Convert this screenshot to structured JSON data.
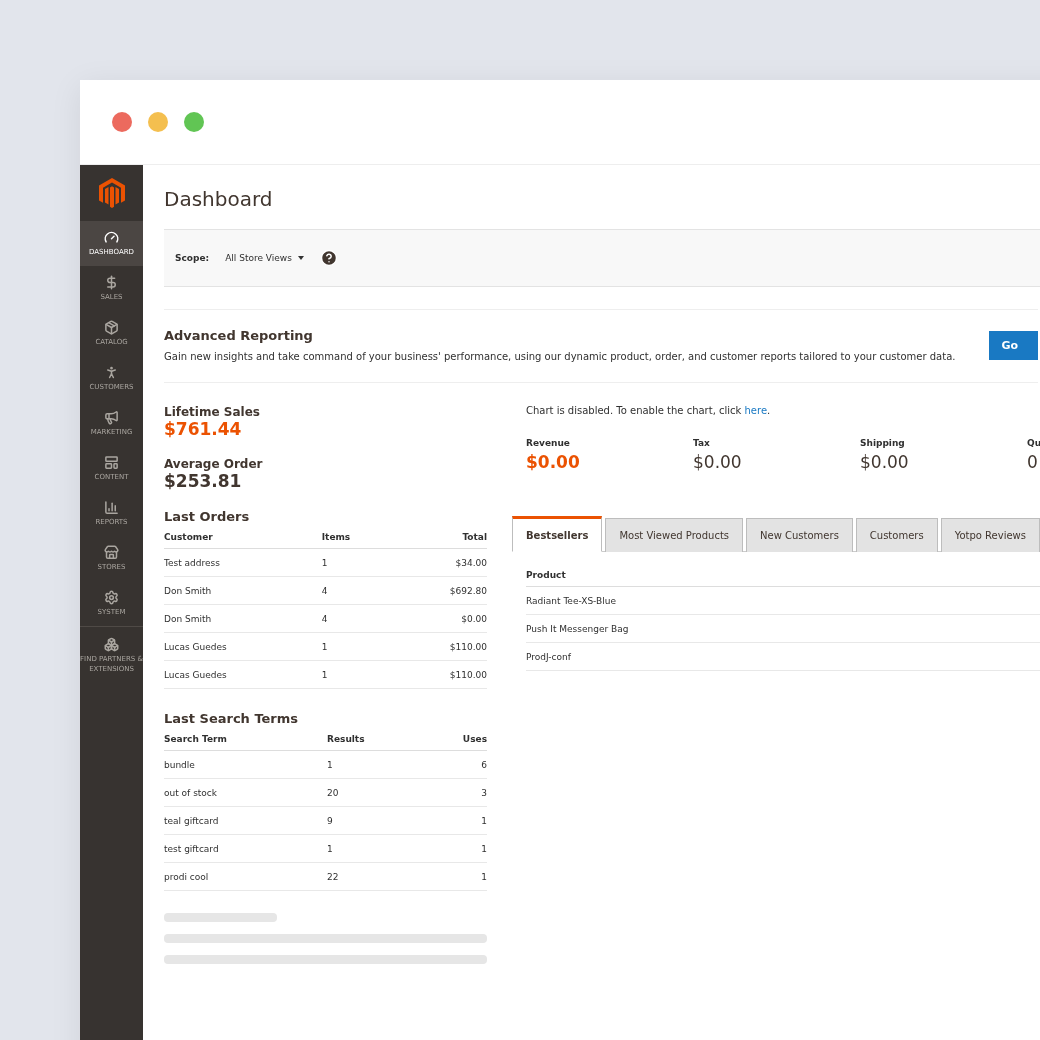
{
  "sidebar": {
    "items": [
      {
        "label": "DASHBOARD",
        "selected": true
      },
      {
        "label": "SALES",
        "selected": false
      },
      {
        "label": "CATALOG",
        "selected": false
      },
      {
        "label": "CUSTOMERS",
        "selected": false
      },
      {
        "label": "MARKETING",
        "selected": false
      },
      {
        "label": "CONTENT",
        "selected": false
      },
      {
        "label": "REPORTS",
        "selected": false
      },
      {
        "label": "STORES",
        "selected": false
      },
      {
        "label": "SYSTEM",
        "selected": false
      },
      {
        "label": "FIND PARTNERS & EXTENSIONS",
        "selected": false
      }
    ]
  },
  "page_title": "Dashboard",
  "scope": {
    "label": "Scope:",
    "value": "All Store Views"
  },
  "advanced_reporting": {
    "title": "Advanced Reporting",
    "text": "Gain new insights and take command of your business' performance, using our dynamic product, order, and customer reports tailored to your customer data.",
    "button": "Go"
  },
  "lifetime_sales": {
    "label": "Lifetime Sales",
    "value": "$761.44"
  },
  "average_order": {
    "label": "Average Order",
    "value": "$253.81"
  },
  "last_orders": {
    "title": "Last Orders",
    "columns": [
      "Customer",
      "Items",
      "Total"
    ],
    "rows": [
      [
        "Test address",
        "1",
        "$34.00"
      ],
      [
        "Don Smith",
        "4",
        "$692.80"
      ],
      [
        "Don Smith",
        "4",
        "$0.00"
      ],
      [
        "Lucas Guedes",
        "1",
        "$110.00"
      ],
      [
        "Lucas Guedes",
        "1",
        "$110.00"
      ]
    ]
  },
  "last_search_terms": {
    "title": "Last Search Terms",
    "columns": [
      "Search Term",
      "Results",
      "Uses"
    ],
    "rows": [
      [
        "bundle",
        "1",
        "6"
      ],
      [
        "out of stock",
        "20",
        "3"
      ],
      [
        "teal giftcard",
        "9",
        "1"
      ],
      [
        "test giftcard",
        "1",
        "1"
      ],
      [
        "prodi cool",
        "22",
        "1"
      ]
    ]
  },
  "chart_notice": {
    "text": "Chart is disabled. To enable the chart, click",
    "link": "here",
    "after_link": "."
  },
  "totals": [
    {
      "label": "Revenue",
      "value": "$0.00",
      "highlight": true
    },
    {
      "label": "Tax",
      "value": "$0.00",
      "highlight": false
    },
    {
      "label": "Shipping",
      "value": "$0.00",
      "highlight": false
    },
    {
      "label": "Qu",
      "value": "0",
      "highlight": false
    }
  ],
  "tabs": [
    {
      "label": "Bestsellers",
      "selected": true
    },
    {
      "label": "Most Viewed Products",
      "selected": false
    },
    {
      "label": "New Customers",
      "selected": false
    },
    {
      "label": "Customers",
      "selected": false
    },
    {
      "label": "Yotpo Reviews",
      "selected": false
    }
  ],
  "products": {
    "column": "Product",
    "rows": [
      "Radiant Tee-XS-Blue",
      "Push It Messenger Bag",
      "ProdJ-conf"
    ]
  }
}
